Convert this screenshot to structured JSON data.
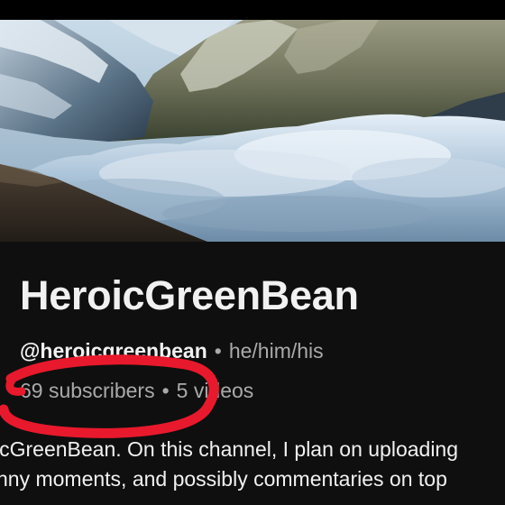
{
  "channel": {
    "name": "HeroicGreenBean",
    "handle": "@heroicgreenbean",
    "pronouns": "he/him/his",
    "subscribers": "69 subscribers",
    "videos": "5 videos",
    "separator": "•",
    "description_line1": "icGreenBean. On this channel, I plan on uploading",
    "description_line2": "nny moments, and possibly commentaries on top"
  },
  "colors": {
    "background": "#0f0f0f",
    "text_primary": "#f1f1f1",
    "text_secondary": "#aaaaaa",
    "annotation": "#e8192c"
  },
  "banner": {
    "icon": "mountain-clouds-banner-image"
  },
  "annotation": {
    "icon": "red-hand-drawn-circle"
  }
}
